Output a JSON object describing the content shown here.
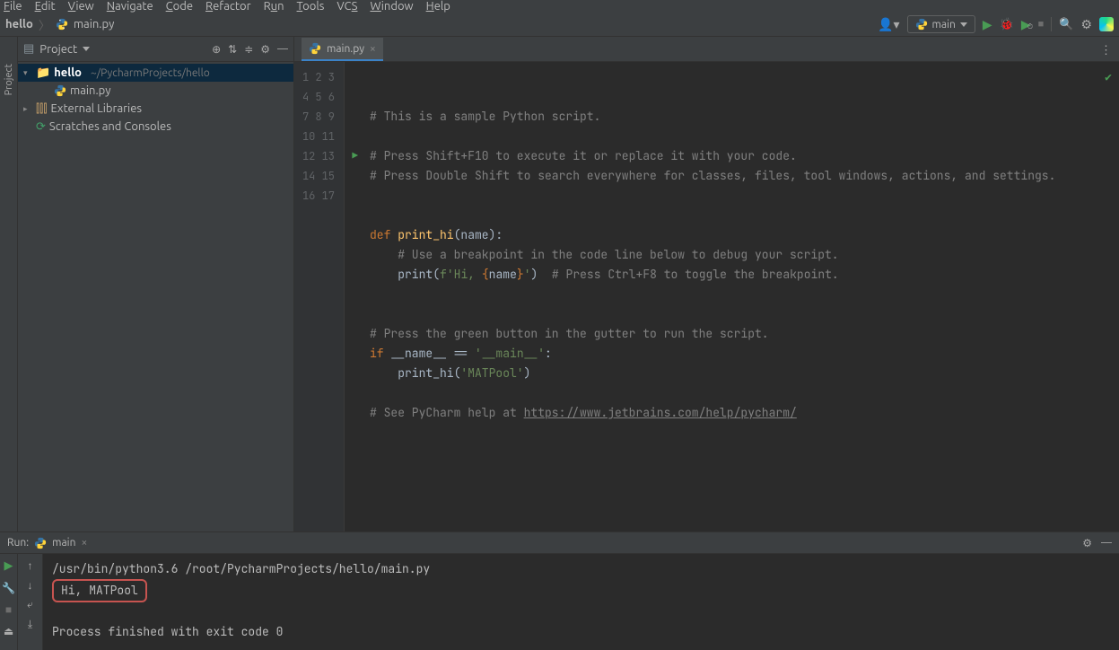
{
  "menu": {
    "file": "File",
    "edit": "Edit",
    "view": "View",
    "navigate": "Navigate",
    "code": "Code",
    "refactor": "Refactor",
    "run": "Run",
    "tools": "Tools",
    "vcs": "VCS",
    "window": "Window",
    "help": "Help"
  },
  "breadcrumb": {
    "project": "hello",
    "file": "main.py"
  },
  "run_config": {
    "name": "main"
  },
  "project_panel": {
    "title": "Project",
    "root": "hello",
    "root_path": "~/PycharmProjects/hello",
    "file": "main.py",
    "external": "External Libraries",
    "scratch": "Scratches and Consoles"
  },
  "editor": {
    "tab_name": "main.py",
    "lines": [
      {
        "n": 1
      },
      {
        "n": 2
      },
      {
        "n": 3
      },
      {
        "n": 4
      },
      {
        "n": 5
      },
      {
        "n": 6
      },
      {
        "n": 7
      },
      {
        "n": 8
      },
      {
        "n": 9
      },
      {
        "n": 10
      },
      {
        "n": 11
      },
      {
        "n": 12
      },
      {
        "n": 13
      },
      {
        "n": 14
      },
      {
        "n": 15
      },
      {
        "n": 16
      },
      {
        "n": 17
      }
    ],
    "code": {
      "l1": "# This is a sample Python script.",
      "l3": "# Press Shift+F10 to execute it or replace it with your code.",
      "l4": "# Press Double Shift to search everywhere for classes, files, tool windows, actions, and settings.",
      "l7_def": "def ",
      "l7_fn": "print_hi",
      "l7_rest": "(name):",
      "l8": "    # Use a breakpoint in the code line below to debug your script.",
      "l9a": "    ",
      "l9_print": "print",
      "l9_paren": "(",
      "l9_f": "f",
      "l9_s1": "'Hi, ",
      "l9_br1": "{",
      "l9_name": "name",
      "l9_br2": "}",
      "l9_s2": "'",
      "l9_paren2": ")",
      "l9_cmt": "  # Press Ctrl+F8 to toggle the breakpoint.",
      "l12": "# Press the green button in the gutter to run the script.",
      "l13_if": "if ",
      "l13_name": "__name__",
      "l13_eq": " == ",
      "l13_str": "'__main__'",
      "l13_colon": ":",
      "l14a": "    print_hi(",
      "l14_str": "'MATPool'",
      "l14b": ")",
      "l16a": "# See PyCharm help at ",
      "l16_url": "https://www.jetbrains.com/help/pycharm/"
    }
  },
  "run_tool": {
    "label": "Run:",
    "config": "main",
    "cmd": "/usr/bin/python3.6 /root/PycharmProjects/hello/main.py",
    "output": "Hi, MATPool",
    "exit": "Process finished with exit code 0"
  }
}
